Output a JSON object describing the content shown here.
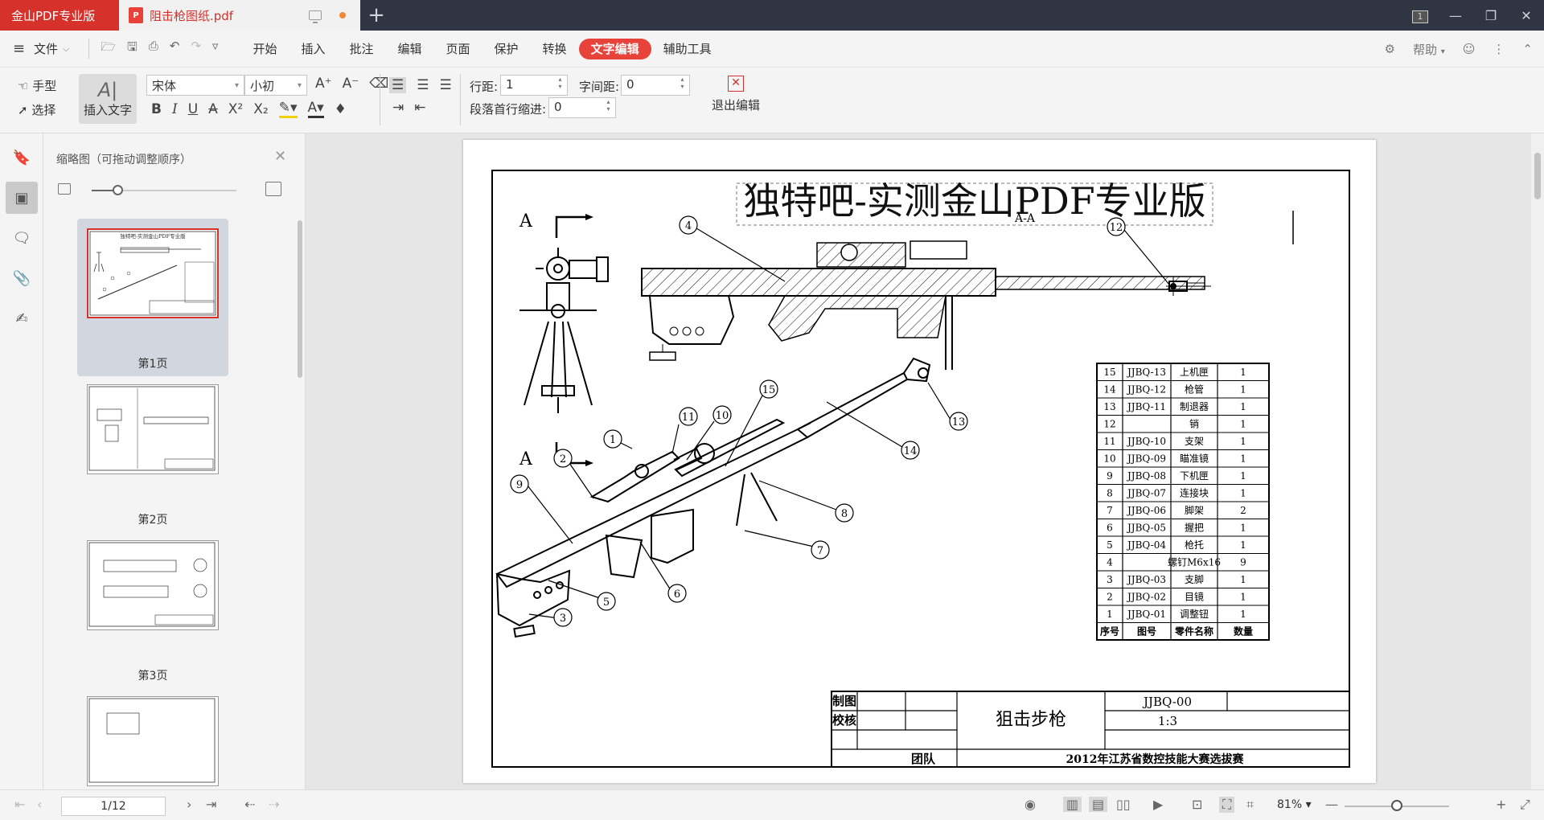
{
  "tabbar": {
    "app_tab": "金山PDF专业版",
    "doc_tab": "阻击枪图纸.pdf",
    "window_page_badge": "1",
    "new_tab_glyph": "+"
  },
  "menubar": {
    "file_label": "文件",
    "tabs": [
      "开始",
      "插入",
      "批注",
      "编辑",
      "页面",
      "保护",
      "转换",
      "文字编辑",
      "辅助工具"
    ],
    "active_tab": "文字编辑",
    "help_label": "帮助"
  },
  "toolbar": {
    "hand_label": "手型",
    "select_label": "选择",
    "insert_text_label": "插入文字",
    "font_family": "宋体",
    "font_size": "小初",
    "line_spacing_label": "行距:",
    "line_spacing_value": "1",
    "char_spacing_label": "字间距:",
    "char_spacing_value": "0",
    "indent_label": "段落首行缩进:",
    "indent_value": "0",
    "exit_edit_label": "退出编辑"
  },
  "thumbnail_panel": {
    "title": "缩略图（可拖动调整顺序）",
    "pages": [
      "第1页",
      "第2页",
      "第3页"
    ],
    "thumb1_title": "独特吧-实测金山PDF专业版"
  },
  "document": {
    "text_box": "独特吧-实测金山PDF专业版",
    "section_label_1": "A",
    "section_label_2": "A",
    "section_mark": "A-A",
    "balloons": [
      "1",
      "2",
      "3",
      "4",
      "5",
      "6",
      "7",
      "8",
      "9",
      "10",
      "11",
      "12",
      "13",
      "14",
      "15"
    ],
    "bom": {
      "headers": [
        "序号",
        "图号",
        "零件名称",
        "数量"
      ],
      "rows": [
        [
          "15",
          "JJBQ-13",
          "上机匣",
          "1"
        ],
        [
          "14",
          "JJBQ-12",
          "枪管",
          "1"
        ],
        [
          "13",
          "JJBQ-11",
          "制退器",
          "1"
        ],
        [
          "12",
          "",
          "销",
          "1"
        ],
        [
          "11",
          "JJBQ-10",
          "支架",
          "1"
        ],
        [
          "10",
          "JJBQ-09",
          "瞄准镜",
          "1"
        ],
        [
          "9",
          "JJBQ-08",
          "下机匣",
          "1"
        ],
        [
          "8",
          "JJBQ-07",
          "连接块",
          "1"
        ],
        [
          "7",
          "JJBQ-06",
          "脚架",
          "2"
        ],
        [
          "6",
          "JJBQ-05",
          "握把",
          "1"
        ],
        [
          "5",
          "JJBQ-04",
          "枪托",
          "1"
        ],
        [
          "4",
          "",
          "螺钉M6x16",
          "9"
        ],
        [
          "3",
          "JJBQ-03",
          "支脚",
          "1"
        ],
        [
          "2",
          "JJBQ-02",
          "目镜",
          "1"
        ],
        [
          "1",
          "JJBQ-01",
          "调整钮",
          "1"
        ]
      ]
    },
    "title_block": {
      "drawn_label": "制图",
      "check_label": "校核",
      "team_label": "团队",
      "part_name": "狙击步枪",
      "drawing_no": "JJBQ-00",
      "scale": "1:3",
      "competition": "2012年江苏省数控技能大赛选拔赛"
    }
  },
  "statusbar": {
    "page_indicator": "1/12",
    "zoom": "81%"
  },
  "colors": {
    "accent": "#e8433a",
    "app_tab": "#d7312b",
    "titlebar": "#2f3542"
  }
}
